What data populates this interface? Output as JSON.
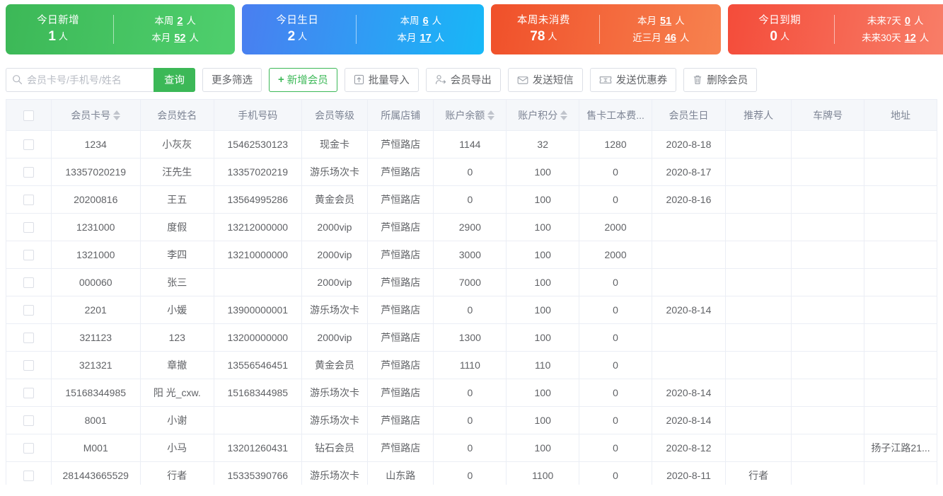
{
  "stats": [
    {
      "id": "new-today",
      "color": "#3cb857",
      "title": "今日新增",
      "main_value": "1",
      "main_unit": "人",
      "rows": [
        {
          "label": "本周",
          "value": "2",
          "unit": "人"
        },
        {
          "label": "本月",
          "value": "52",
          "unit": "人"
        }
      ]
    },
    {
      "id": "birthday-today",
      "color": "#4a7ef0",
      "title": "今日生日",
      "main_value": "2",
      "main_unit": "人",
      "rows": [
        {
          "label": "本周",
          "value": "6",
          "unit": "人"
        },
        {
          "label": "本月",
          "value": "17",
          "unit": "人"
        }
      ]
    },
    {
      "id": "no-consumption-week",
      "color": "#f0502a",
      "title": "本周未消费",
      "main_value": "78",
      "main_unit": "人",
      "rows": [
        {
          "label": "本月",
          "value": "51",
          "unit": "人"
        },
        {
          "label": "近三月",
          "value": "46",
          "unit": "人"
        }
      ]
    },
    {
      "id": "expiring-today",
      "color": "#f44c3a",
      "title": "今日到期",
      "main_value": "0",
      "main_unit": "人",
      "rows": [
        {
          "label": "未来7天",
          "value": "0",
          "unit": "人"
        },
        {
          "label": "未来30天",
          "value": "12",
          "unit": "人"
        }
      ]
    }
  ],
  "toolbar": {
    "search_placeholder": "会员卡号/手机号/姓名",
    "search_value": "",
    "search_button": "查询",
    "more_filters": "更多筛选",
    "add_member": "新增会员",
    "add_member_plus": "+",
    "buttons": [
      {
        "id": "batch-import",
        "label": "批量导入",
        "icon": "import-icon"
      },
      {
        "id": "member-export",
        "label": "会员导出",
        "icon": "person-export-icon"
      },
      {
        "id": "send-sms",
        "label": "发送短信",
        "icon": "envelope-icon"
      },
      {
        "id": "send-coupon",
        "label": "发送优惠券",
        "icon": "ticket-icon"
      },
      {
        "id": "delete-member",
        "label": "删除会员",
        "icon": "trash-icon"
      }
    ]
  },
  "table": {
    "columns": [
      {
        "key": "checkbox",
        "label": "",
        "sortable": false
      },
      {
        "key": "card_no",
        "label": "会员卡号",
        "sortable": true
      },
      {
        "key": "name",
        "label": "会员姓名",
        "sortable": false
      },
      {
        "key": "phone",
        "label": "手机号码",
        "sortable": false
      },
      {
        "key": "level",
        "label": "会员等级",
        "sortable": false
      },
      {
        "key": "shop",
        "label": "所属店铺",
        "sortable": false
      },
      {
        "key": "balance",
        "label": "账户余额",
        "sortable": true
      },
      {
        "key": "points",
        "label": "账户积分",
        "sortable": true
      },
      {
        "key": "card_fee",
        "label": "售卡工本费...",
        "sortable": false
      },
      {
        "key": "birthday",
        "label": "会员生日",
        "sortable": false
      },
      {
        "key": "referrer",
        "label": "推荐人",
        "sortable": false
      },
      {
        "key": "plate",
        "label": "车牌号",
        "sortable": false
      },
      {
        "key": "address",
        "label": "地址",
        "sortable": false
      }
    ],
    "rows": [
      {
        "card_no": "1234",
        "name": "小灰灰",
        "phone": "15462530123",
        "level": "现金卡",
        "shop": "芦恒路店",
        "balance": "1144",
        "points": "32",
        "card_fee": "1280",
        "birthday": "2020-8-18",
        "referrer": "",
        "plate": "",
        "address": ""
      },
      {
        "card_no": "13357020219",
        "name": "汪先生",
        "phone": "13357020219",
        "level": "游乐场次卡",
        "shop": "芦恒路店",
        "balance": "0",
        "points": "100",
        "card_fee": "0",
        "birthday": "2020-8-17",
        "referrer": "",
        "plate": "",
        "address": ""
      },
      {
        "card_no": "20200816",
        "name": "王五",
        "phone": "13564995286",
        "level": "黄金会员",
        "shop": "芦恒路店",
        "balance": "0",
        "points": "100",
        "card_fee": "0",
        "birthday": "2020-8-16",
        "referrer": "",
        "plate": "",
        "address": ""
      },
      {
        "card_no": "1231000",
        "name": "度假",
        "phone": "13212000000",
        "level": "2000vip",
        "shop": "芦恒路店",
        "balance": "2900",
        "points": "100",
        "card_fee": "2000",
        "birthday": "",
        "referrer": "",
        "plate": "",
        "address": ""
      },
      {
        "card_no": "1321000",
        "name": "李四",
        "phone": "13210000000",
        "level": "2000vip",
        "shop": "芦恒路店",
        "balance": "3000",
        "points": "100",
        "card_fee": "2000",
        "birthday": "",
        "referrer": "",
        "plate": "",
        "address": ""
      },
      {
        "card_no": "000060",
        "name": "张三",
        "phone": "",
        "level": "2000vip",
        "shop": "芦恒路店",
        "balance": "7000",
        "points": "100",
        "card_fee": "0",
        "birthday": "",
        "referrer": "",
        "plate": "",
        "address": ""
      },
      {
        "card_no": "2201",
        "name": "小媛",
        "phone": "13900000001",
        "level": "游乐场次卡",
        "shop": "芦恒路店",
        "balance": "0",
        "points": "100",
        "card_fee": "0",
        "birthday": "2020-8-14",
        "referrer": "",
        "plate": "",
        "address": ""
      },
      {
        "card_no": "321123",
        "name": "123",
        "phone": "13200000000",
        "level": "2000vip",
        "shop": "芦恒路店",
        "balance": "1300",
        "points": "100",
        "card_fee": "0",
        "birthday": "",
        "referrer": "",
        "plate": "",
        "address": ""
      },
      {
        "card_no": "321321",
        "name": "章撤",
        "phone": "13556546451",
        "level": "黄金会员",
        "shop": "芦恒路店",
        "balance": "1110",
        "points": "110",
        "card_fee": "0",
        "birthday": "",
        "referrer": "",
        "plate": "",
        "address": ""
      },
      {
        "card_no": "15168344985",
        "name": "阳 光_cxw.",
        "phone": "15168344985",
        "level": "游乐场次卡",
        "shop": "芦恒路店",
        "balance": "0",
        "points": "100",
        "card_fee": "0",
        "birthday": "2020-8-14",
        "referrer": "",
        "plate": "",
        "address": ""
      },
      {
        "card_no": "8001",
        "name": "小谢",
        "phone": "",
        "level": "游乐场次卡",
        "shop": "芦恒路店",
        "balance": "0",
        "points": "100",
        "card_fee": "0",
        "birthday": "2020-8-14",
        "referrer": "",
        "plate": "",
        "address": ""
      },
      {
        "card_no": "M001",
        "name": "小马",
        "phone": "13201260431",
        "level": "钻石会员",
        "shop": "芦恒路店",
        "balance": "0",
        "points": "100",
        "card_fee": "0",
        "birthday": "2020-8-12",
        "referrer": "",
        "plate": "",
        "address": "扬子江路21..."
      },
      {
        "card_no": "281443665529",
        "name": "行者",
        "phone": "15335390766",
        "level": "游乐场次卡",
        "shop": "山东路",
        "balance": "0",
        "points": "1100",
        "card_fee": "0",
        "birthday": "2020-8-11",
        "referrer": "行者",
        "plate": "",
        "address": ""
      }
    ]
  }
}
